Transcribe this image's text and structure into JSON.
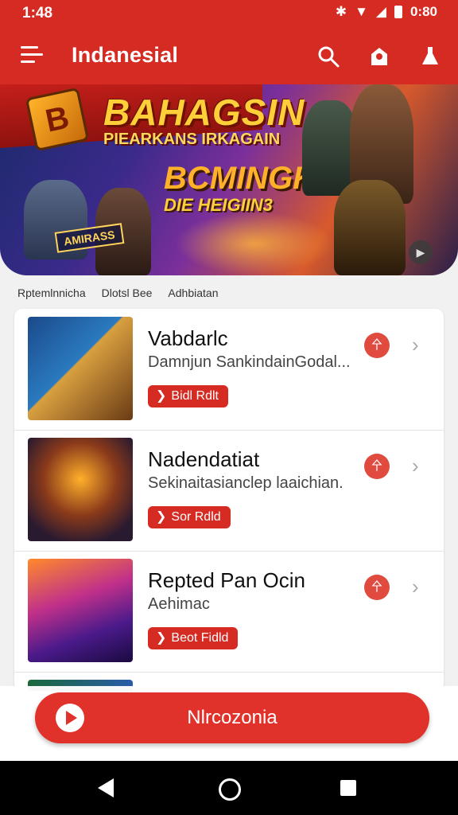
{
  "status_bar": {
    "time": "1:48",
    "clock_right": "0:80"
  },
  "app_bar": {
    "title": "Indanesial"
  },
  "banner": {
    "title": "BAHAGSIN",
    "subtitle": "PIEARKANS IRKAGAIN",
    "logo_top": "BCMINGK",
    "logo_bottom": "DIE HEIGIIN3",
    "tag": "AMIRASS"
  },
  "filters": [
    "Rptemlnnicha",
    "Dlotsl Bee",
    "Adhbiatan"
  ],
  "games": [
    {
      "title": "Vabdarlc",
      "description": "Damnjun SankindainGodal...",
      "button": "Bidl Rdlt",
      "badge": "㐃"
    },
    {
      "title": "Nadendatiat",
      "description": "Sekinaitasianclep laaichian.",
      "button": "Sor Rdld",
      "badge": "㐃"
    },
    {
      "title": "Repted Pan Ocin",
      "description": "Aehimac",
      "button": "Beot Fidld",
      "badge": "㐃"
    }
  ],
  "cta": {
    "label": "Nlrcozonia"
  },
  "colors": {
    "primary": "#d62b22",
    "cta": "#e0312a"
  }
}
